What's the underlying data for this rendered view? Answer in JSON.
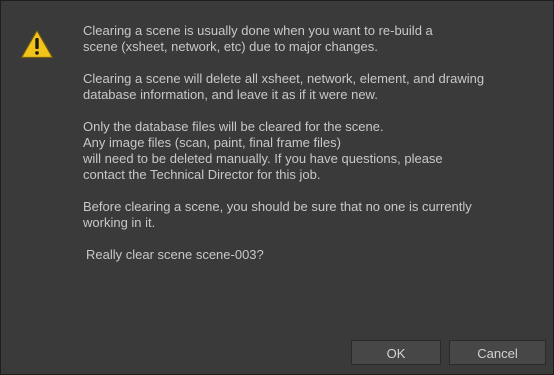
{
  "dialog": {
    "icon": "warning-icon",
    "paragraphs": [
      "Clearing a scene is usually done when you want to re-build a\nscene (xsheet, network, etc) due to major changes.",
      "Clearing a scene will delete all xsheet, network, element, and drawing\ndatabase information, and leave it as if it were new.",
      "Only the database files will be cleared for the scene.\nAny image files (scan, paint, final frame files)\nwill need to be deleted manually.  If you have questions, please\ncontact the Technical Director for this job.",
      "Before clearing a scene, you should be sure that no one is currently\nworking in it."
    ],
    "question": "Really clear scene scene-003?",
    "buttons": {
      "ok": "OK",
      "cancel": "Cancel"
    }
  },
  "colors": {
    "background": "#3a3a3a",
    "text": "#c8c8c8",
    "warning_yellow": "#f2c318"
  }
}
